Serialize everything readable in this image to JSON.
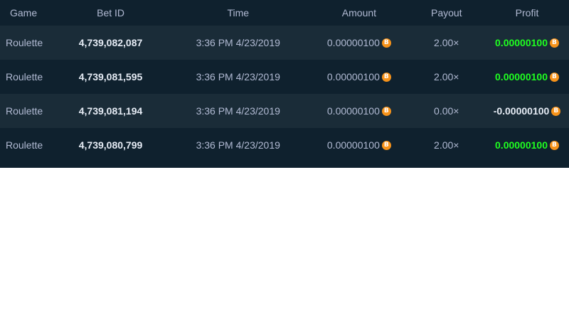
{
  "table": {
    "columns": {
      "game": "Game",
      "bet_id": "Bet ID",
      "time": "Time",
      "amount": "Amount",
      "payout": "Payout",
      "profit": "Profit"
    },
    "currency_icon": "bitcoin-icon",
    "colors": {
      "background": "#0f212e",
      "row_alt": "#1a2c38",
      "profit_positive": "#1fff20",
      "text_muted": "#b1bad3",
      "text_bright": "#e6ecf5",
      "coin": "#f7931a"
    },
    "rows": [
      {
        "game": "Roulette",
        "bet_id": "4,739,082,087",
        "time": "3:36 PM 4/23/2019",
        "amount": "0.00000100",
        "payout": "2.00×",
        "profit": "0.00000100"
      },
      {
        "game": "Roulette",
        "bet_id": "4,739,081,595",
        "time": "3:36 PM 4/23/2019",
        "amount": "0.00000100",
        "payout": "2.00×",
        "profit": "0.00000100"
      },
      {
        "game": "Roulette",
        "bet_id": "4,739,081,194",
        "time": "3:36 PM 4/23/2019",
        "amount": "0.00000100",
        "payout": "0.00×",
        "profit": "-0.00000100"
      },
      {
        "game": "Roulette",
        "bet_id": "4,739,080,799",
        "time": "3:36 PM 4/23/2019",
        "amount": "0.00000100",
        "payout": "2.00×",
        "profit": "0.00000100"
      }
    ]
  }
}
